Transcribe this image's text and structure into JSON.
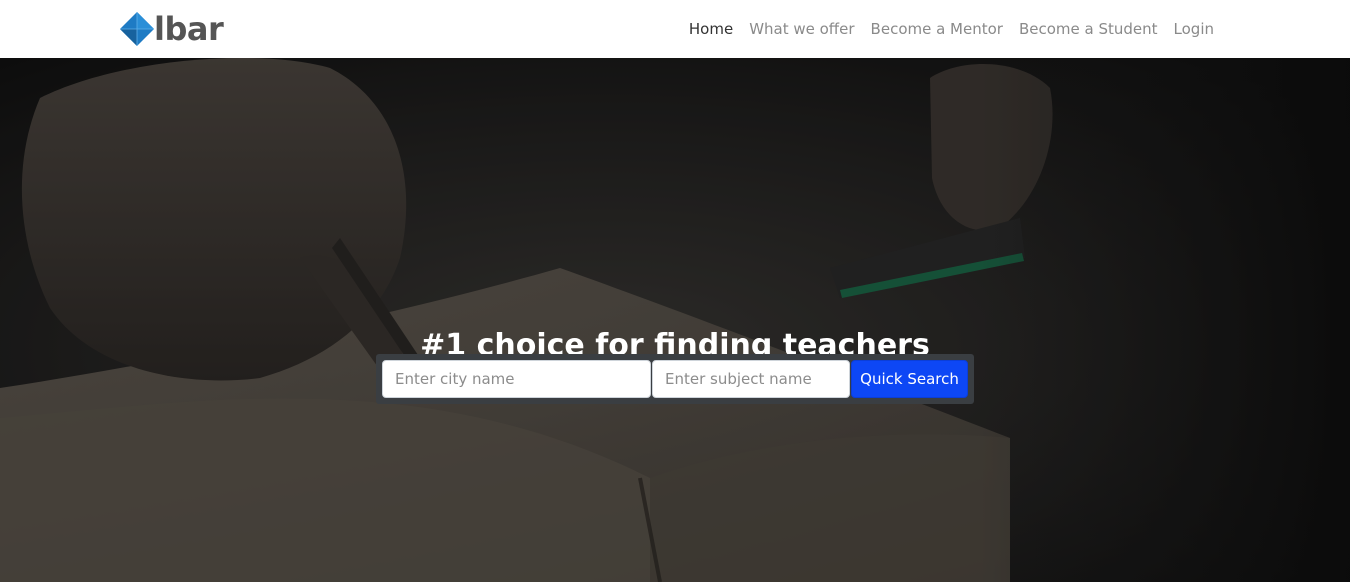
{
  "brand": {
    "name": "lbar",
    "logo_icon": "diamond-logo-icon",
    "logo_color": "#1e7bc4"
  },
  "nav": {
    "items": [
      {
        "label": "Home",
        "active": true
      },
      {
        "label": "What we offer",
        "active": false
      },
      {
        "label": "Become a Mentor",
        "active": false
      },
      {
        "label": "Become a Student",
        "active": false
      },
      {
        "label": "Login",
        "active": false
      }
    ]
  },
  "hero": {
    "title": "#1 choice for finding teachers",
    "background_image": "dark photo of hands writing in a notebook"
  },
  "search": {
    "city_placeholder": "Enter city name",
    "city_value": "",
    "subject_placeholder": "Enter subject name",
    "subject_value": "",
    "button_label": "Quick Search",
    "button_color": "#0d47f5"
  }
}
